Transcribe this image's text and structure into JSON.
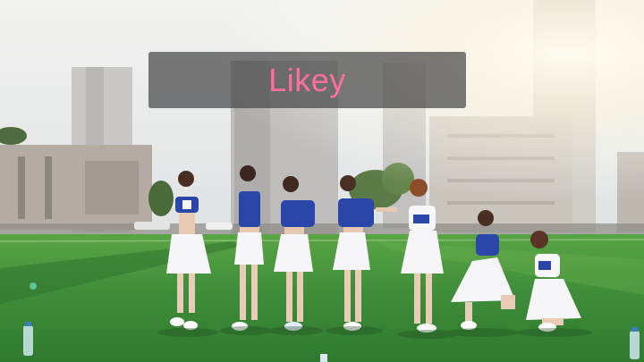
{
  "video": {
    "caption_text": "Likey",
    "caption_text_color": "#ff6f9e",
    "scene_description_icon": "dance-group-on-field-image"
  },
  "colors": {
    "grass": "#3f8d3a",
    "sky": "#eef1f2",
    "uniform_blue": "#2946a8",
    "skirt_white": "#f6f6f8"
  }
}
